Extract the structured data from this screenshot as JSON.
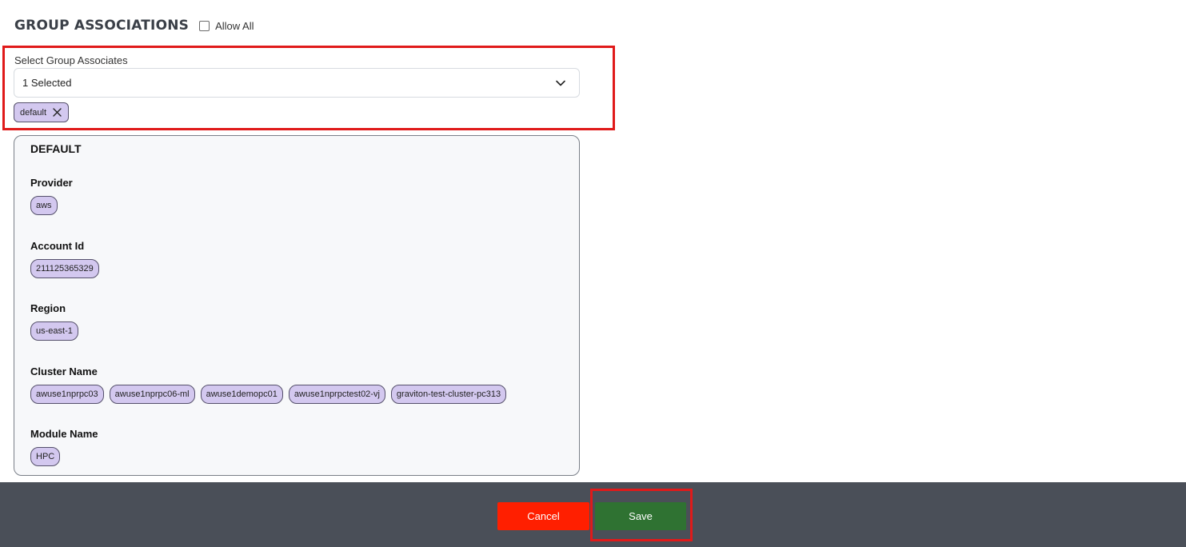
{
  "header": {
    "title": "GROUP ASSOCIATIONS",
    "allow_all_label": "Allow All"
  },
  "select": {
    "label": "Select Group Associates",
    "value": "1 Selected",
    "tags": [
      "default"
    ]
  },
  "card": {
    "title": "DEFAULT",
    "sections": [
      {
        "label": "Provider",
        "chips": [
          "aws"
        ]
      },
      {
        "label": "Account Id",
        "chips": [
          "211125365329"
        ]
      },
      {
        "label": "Region",
        "chips": [
          "us-east-1"
        ]
      },
      {
        "label": "Cluster Name",
        "chips": [
          "awuse1nprpc03",
          "awuse1nprpc06-ml",
          "awuse1demopc01",
          "awuse1nprpctest02-vj",
          "graviton-test-cluster-pc313"
        ]
      },
      {
        "label": "Module Name",
        "chips": [
          "HPC"
        ]
      }
    ]
  },
  "footer": {
    "cancel_label": "Cancel",
    "save_label": "Save"
  },
  "colors": {
    "chip_bg": "#d3c8ef",
    "highlight": "#e01a1a",
    "cancel": "#ff1f00",
    "save": "#2f7232",
    "footer_bg": "#4a4f58"
  }
}
